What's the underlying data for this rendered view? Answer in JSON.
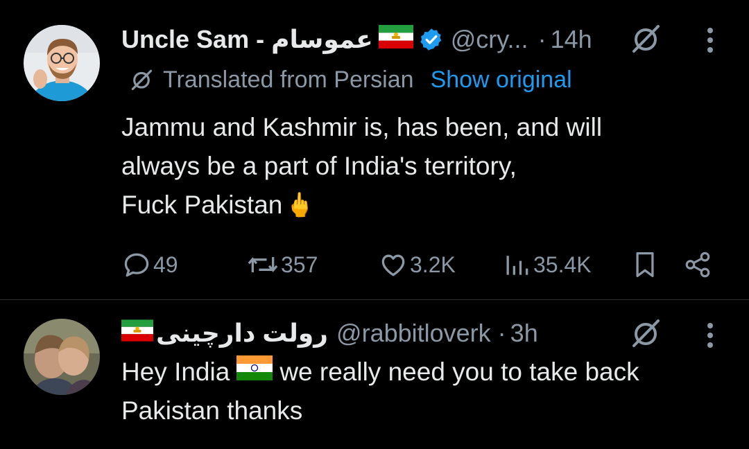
{
  "post1": {
    "display_name": "Uncle Sam - عموسام",
    "handle": "@cry...",
    "separator": "·",
    "time": "14h",
    "translated_label": "Translated from Persian",
    "show_original": "Show original",
    "text_lines": [
      "Jammu and Kashmir is, has been, and will",
      "always be a part of India's territory,",
      "Fuck Pakistan"
    ],
    "emoji": "🖕",
    "flag_icon": "iran-lion-sun-flag-icon",
    "verified_icon": "verified-badge-icon",
    "stats": {
      "replies": "49",
      "reposts": "357",
      "likes": "3.2K",
      "views": "35.4K"
    }
  },
  "post2": {
    "display_name": "رولت دارچینی",
    "handle": "@rabbitloverk",
    "separator": "·",
    "time": "3h",
    "text_line1_before": "Hey India",
    "text_line1_after": "we really need you to take back",
    "text_line2": "Pakistan thanks",
    "flag_icon": "iran-lion-sun-flag-icon",
    "inline_flag_icon": "india-flag-icon"
  },
  "colors": {
    "background": "#000000",
    "text": "#e7e9ea",
    "muted": "#8b98a5",
    "accent": "#1d9bf0",
    "divider": "#2f3336"
  }
}
